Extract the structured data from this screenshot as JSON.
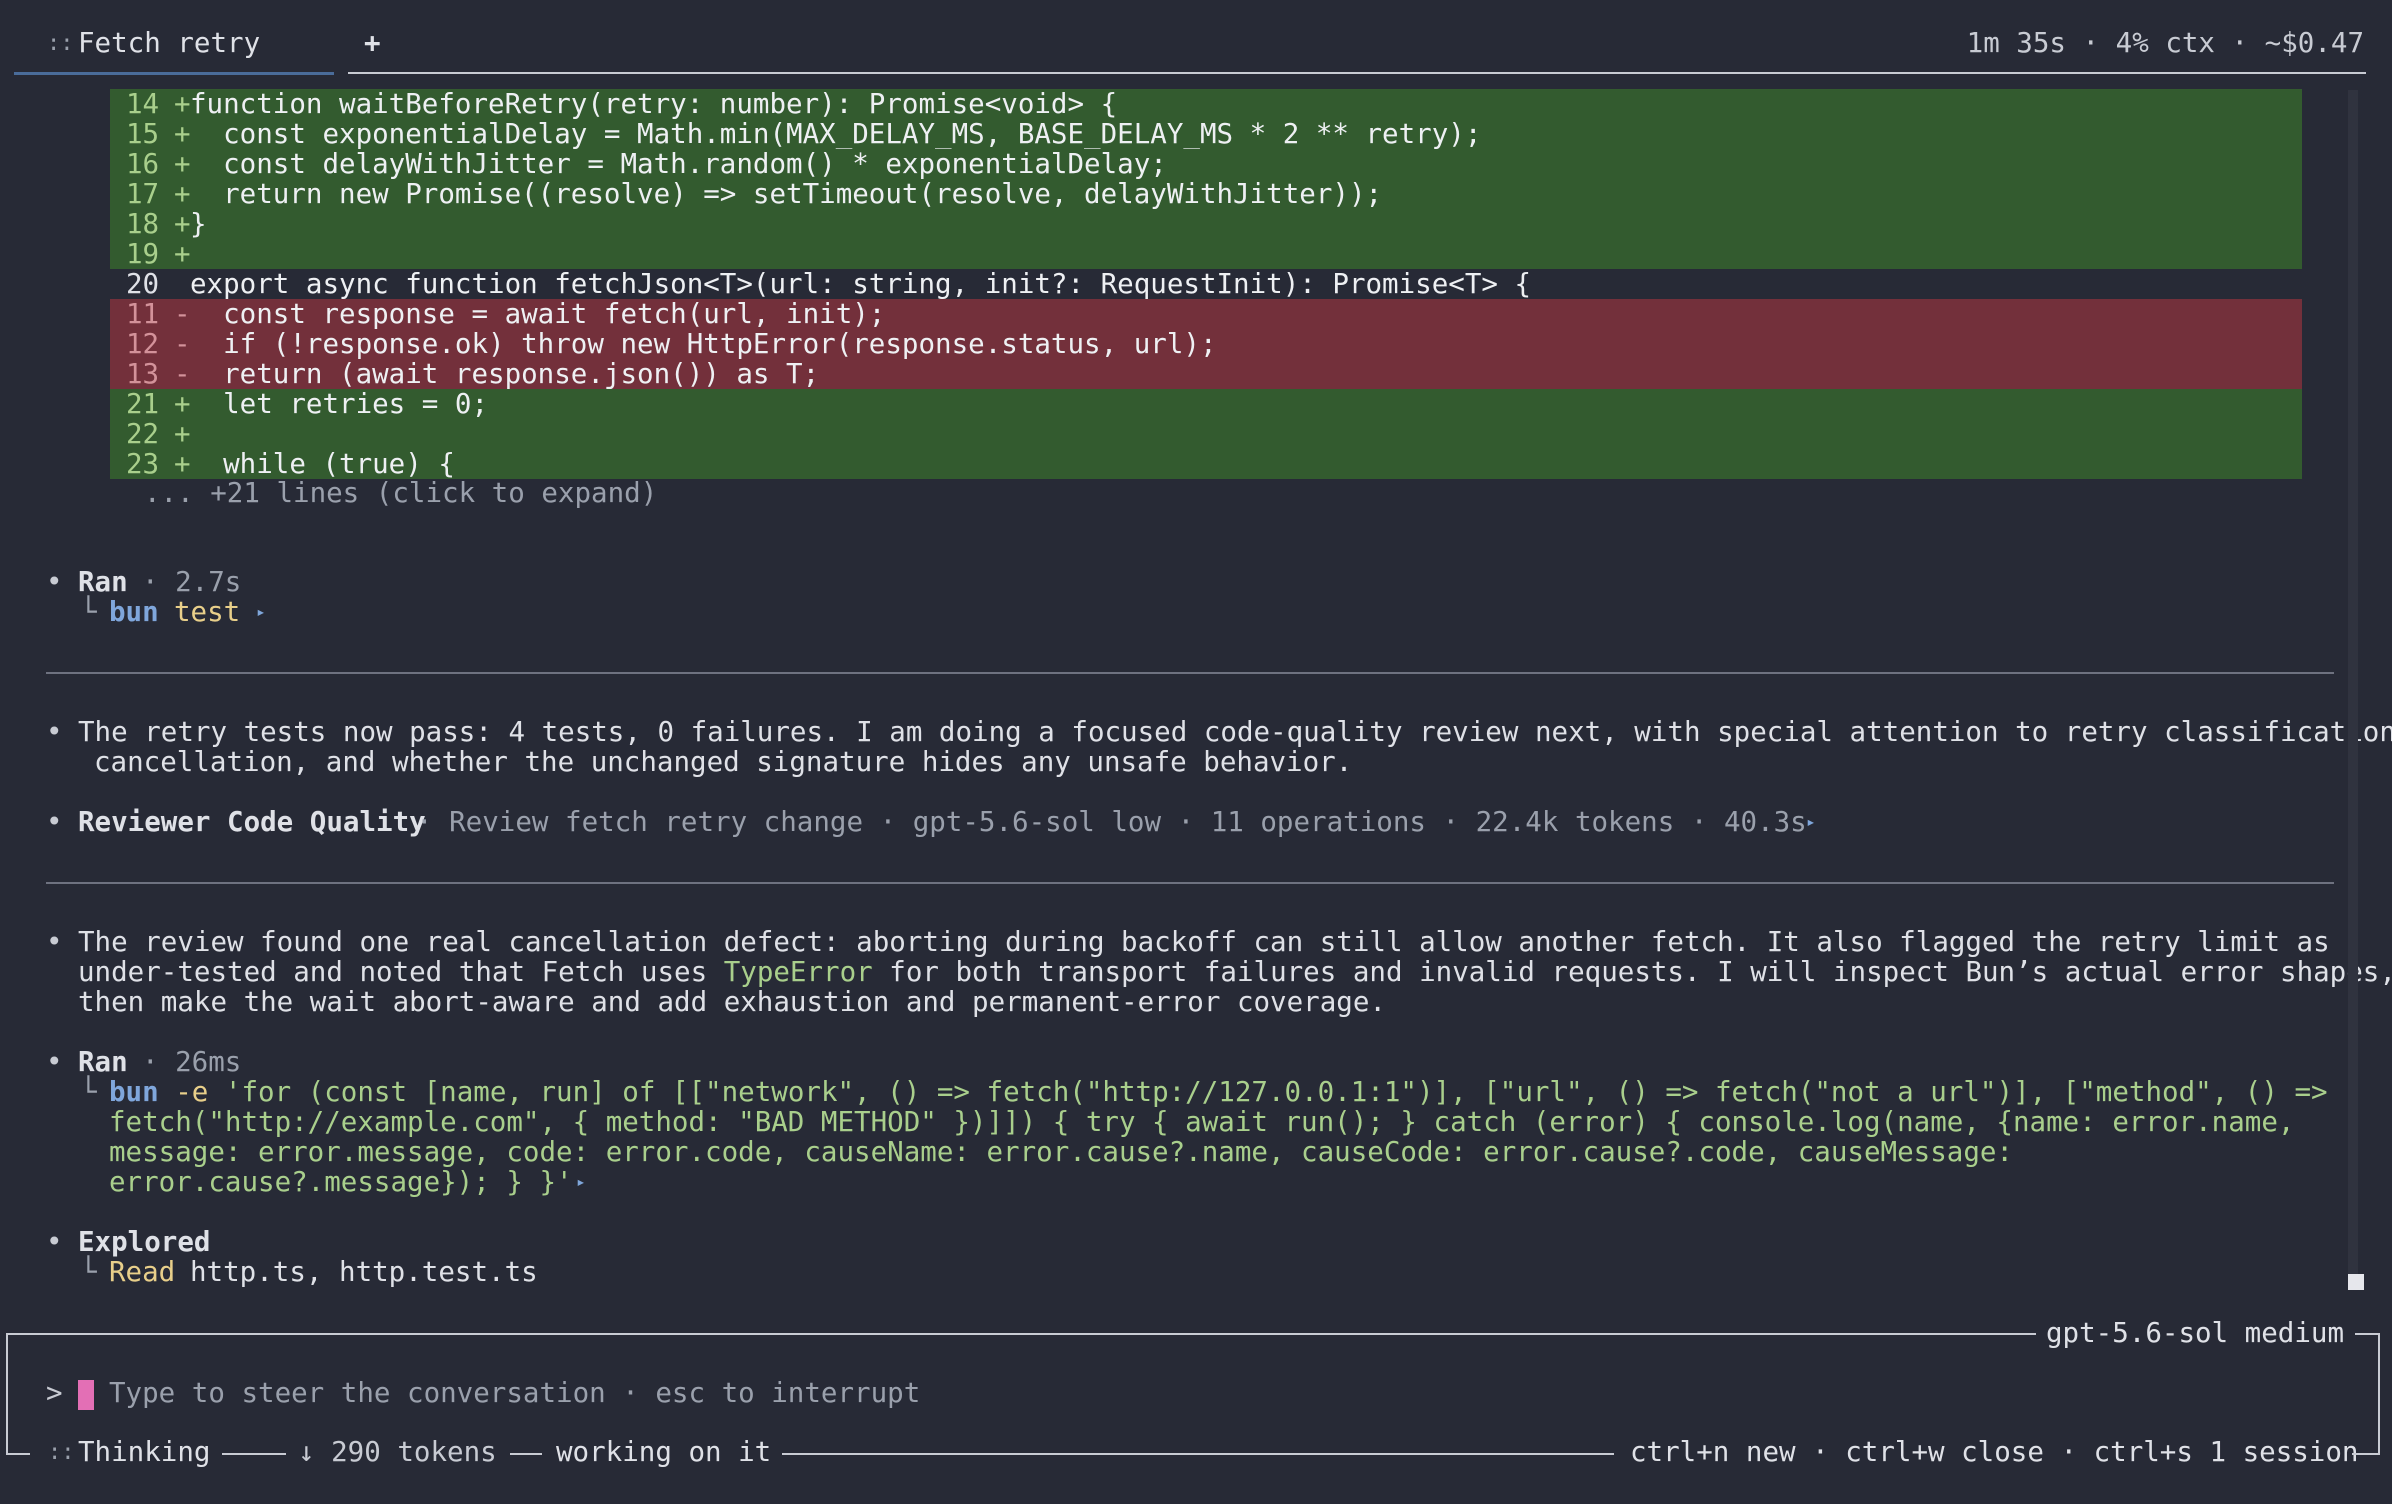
{
  "tab": {
    "handle": "::",
    "title": "Fetch retry",
    "add": "+"
  },
  "status": "1m 35s · 4% ctx · ~$0.47",
  "diff": {
    "rows": [
      {
        "type": "add",
        "ln": "14",
        "mk": "+",
        "code": "function waitBeforeRetry(retry: number): Promise<void> {"
      },
      {
        "type": "add",
        "ln": "15",
        "mk": "+",
        "code": "  const exponentialDelay = Math.min(MAX_DELAY_MS, BASE_DELAY_MS * 2 ** retry);"
      },
      {
        "type": "add",
        "ln": "16",
        "mk": "+",
        "code": "  const delayWithJitter = Math.random() * exponentialDelay;"
      },
      {
        "type": "add",
        "ln": "17",
        "mk": "+",
        "code": "  return new Promise((resolve) => setTimeout(resolve, delayWithJitter));"
      },
      {
        "type": "add",
        "ln": "18",
        "mk": "+",
        "code": "}"
      },
      {
        "type": "add",
        "ln": "19",
        "mk": "+",
        "code": ""
      },
      {
        "type": "ctx",
        "ln": "20",
        "mk": " ",
        "code": "export async function fetchJson<T>(url: string, init?: RequestInit): Promise<T> {"
      },
      {
        "type": "del",
        "ln": "11",
        "mk": "-",
        "code": "  const response = await fetch(url, init);"
      },
      {
        "type": "del",
        "ln": "12",
        "mk": "-",
        "code": "  if (!response.ok) throw new HttpError(response.status, url);"
      },
      {
        "type": "del",
        "ln": "13",
        "mk": "-",
        "code": "  return (await response.json()) as T;"
      },
      {
        "type": "add",
        "ln": "21",
        "mk": "+",
        "code": "  let retries = 0;"
      },
      {
        "type": "add",
        "ln": "22",
        "mk": "+",
        "code": ""
      },
      {
        "type": "add",
        "ln": "23",
        "mk": "+",
        "code": "  while (true) {"
      }
    ],
    "expand": "... +21 lines (click to expand)"
  },
  "ran1": {
    "label": "Ran",
    "meta": "· 2.7s",
    "corner": "└",
    "cmd": "bun",
    "arg": "test",
    "arrow": "▸"
  },
  "msg1": {
    "line1": "The retry tests now pass: 4 tests, 0 failures. I am doing a focused code-quality review next, with special attention to retry classification,",
    "line2": "cancellation, and whether the unchanged signature hides any unsafe behavior."
  },
  "reviewer": {
    "name": "Reviewer Code Quality",
    "meta": "· Review fetch retry change · gpt-5.6-sol low · 11 operations · 22.4k tokens · 40.3s",
    "arrow": "▸"
  },
  "msg2": {
    "line1": "The review found one real cancellation defect: aborting during backoff can still allow another fetch. It also flagged the retry limit as",
    "line2a": "under-tested and noted that Fetch uses ",
    "line2b": "TypeError",
    "line2c": " for both transport failures and invalid requests. I will inspect Bun’s actual error shapes,",
    "line3": "then make the wait abort-aware and add exhaustion and permanent-error coverage."
  },
  "ran2": {
    "label": "Ran",
    "meta": "· 26ms",
    "corner": "└",
    "cmd": "bun",
    "flag": "-e",
    "line1": " 'for (const [name, run] of [[\"network\", () => fetch(\"http://127.0.0.1:1\")], [\"url\", () => fetch(\"not a url\")], [\"method\", () =>",
    "line2": "fetch(\"http://example.com\", { method: \"BAD METHOD\" })]]) { try { await run(); } catch (error) { console.log(name, {name: error.name,",
    "line3": "message: error.message, code: error.code, causeName: error.cause?.name, causeCode: error.cause?.code, causeMessage:",
    "line4": "error.cause?.message}); } }'",
    "arrow": "▸"
  },
  "explored": {
    "label": "Explored",
    "corner": "└",
    "verb": "Read",
    "files": "http.ts, http.test.ts"
  },
  "input": {
    "model": "gpt-5.6-sol medium",
    "prompt": ">",
    "placeholder": "Type to steer the conversation · esc to interrupt"
  },
  "footer": {
    "handle": "::",
    "thinking": "Thinking",
    "tokens": "↓ 290 tokens",
    "working": "working on it",
    "shortcuts": "ctrl+n new · ctrl+w close · ctrl+s 1 session"
  },
  "bullet": "•"
}
